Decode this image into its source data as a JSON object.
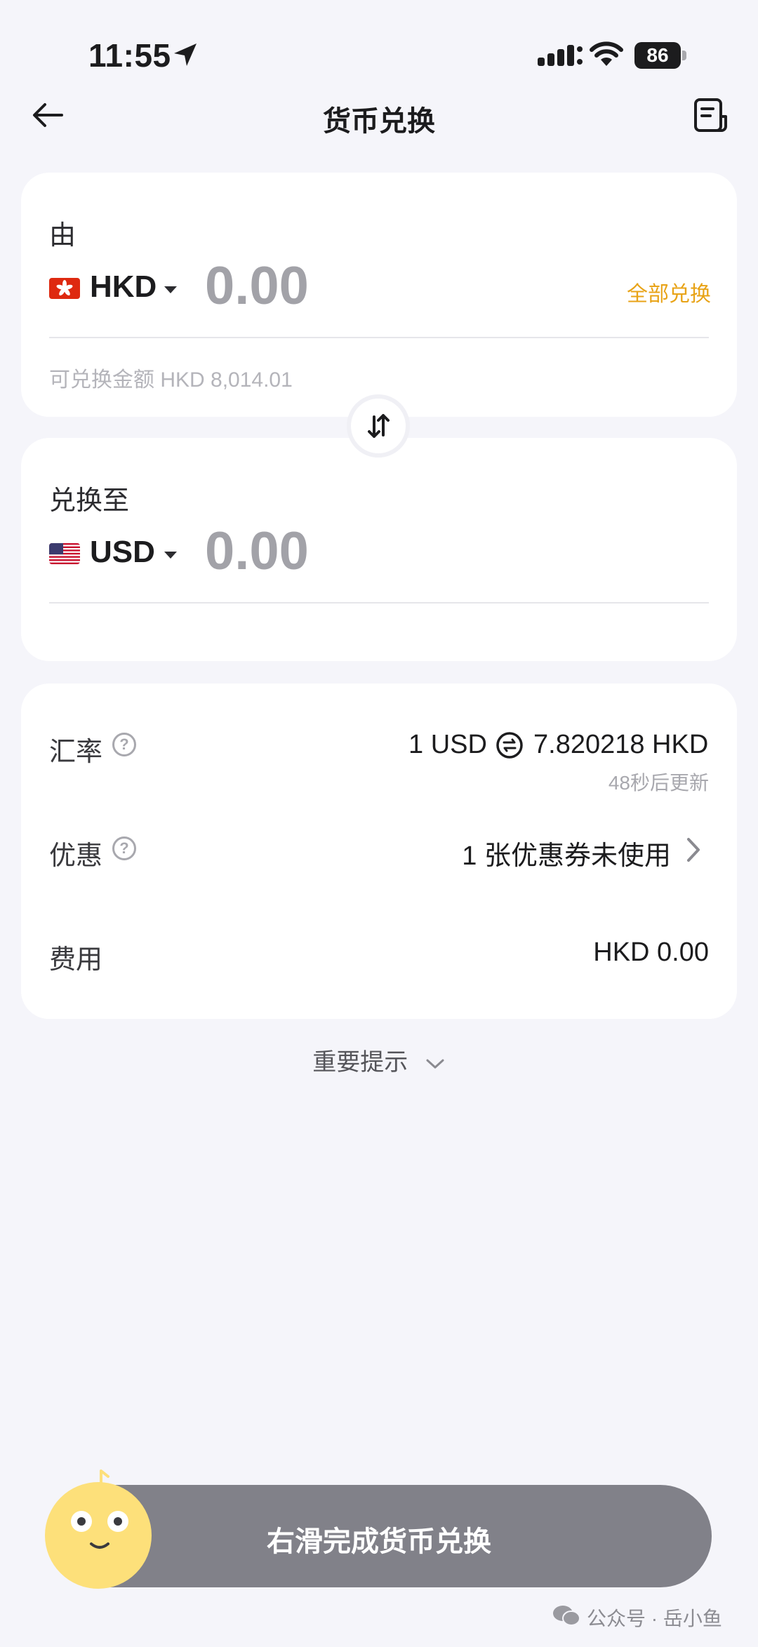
{
  "status_bar": {
    "time": "11:55",
    "battery": "86"
  },
  "nav": {
    "title": "货币兑换"
  },
  "from_card": {
    "label": "由",
    "currency": "HKD",
    "amount": "0.00",
    "convert_all_label": "全部兑换",
    "available": "可兑换金额 HKD 8,014.01"
  },
  "to_card": {
    "label": "兑换至",
    "currency": "USD",
    "amount": "0.00"
  },
  "details": {
    "rate_label": "汇率",
    "rate_left": "1 USD",
    "rate_right": "7.820218 HKD",
    "rate_update": "48秒后更新",
    "discount_label": "优惠",
    "discount_value": "1 张优惠券未使用",
    "fee_label": "费用",
    "fee_value": "HKD 0.00"
  },
  "tips_label": "重要提示",
  "slider_label": "右滑完成货币兑换",
  "watermark": "公众号 · 岳小鱼",
  "colors": {
    "accent": "#e8a317",
    "background": "#f5f5fa",
    "slider": "#818189",
    "knob": "#fde07a"
  }
}
